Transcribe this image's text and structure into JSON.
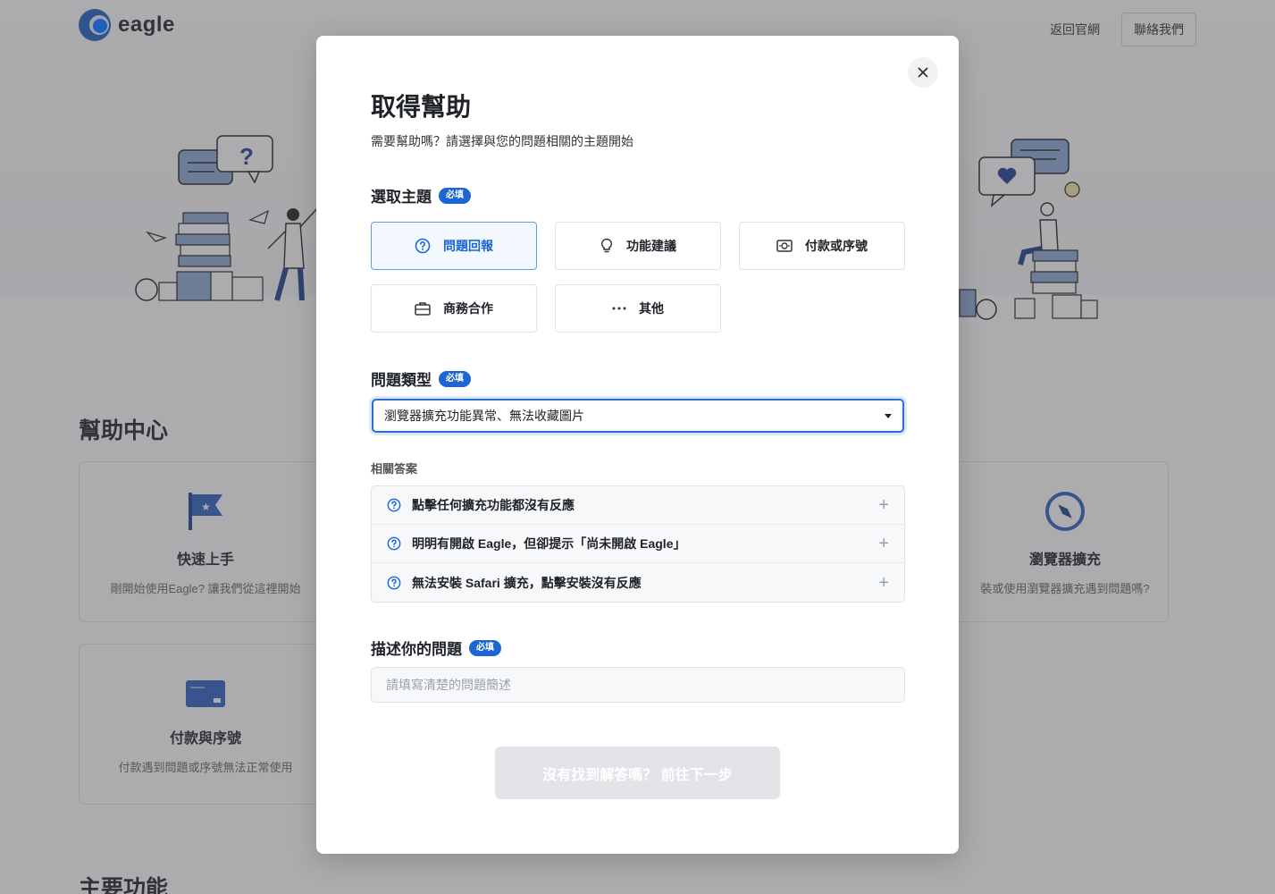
{
  "background": {
    "logo_text": "eagle",
    "nav": {
      "back_link": "返回官網",
      "contact_button": "聯絡我們"
    },
    "help_center_title": "幫助中心",
    "main_features_title": "主要功能",
    "cards": [
      {
        "title": "快速上手",
        "desc": "剛開始使用Eagle? 讓我們從這裡開始"
      },
      {
        "title": "瀏覽器擴充",
        "desc": "裝或使用瀏覽器擴充遇到問題嗎?"
      },
      {
        "title": "付款與序號",
        "desc": "付款遇到問題或序號無法正常使用"
      }
    ]
  },
  "modal": {
    "title": "取得幫助",
    "subtitle": "需要幫助嗎？請選擇與您的問題相關的主題開始",
    "required_badge": "必填",
    "topic": {
      "label": "選取主題",
      "options": [
        {
          "label": "問題回報",
          "icon": "question-circle-icon",
          "selected": true
        },
        {
          "label": "功能建議",
          "icon": "lightbulb-icon",
          "selected": false
        },
        {
          "label": "付款或序號",
          "icon": "money-icon",
          "selected": false
        },
        {
          "label": "商務合作",
          "icon": "briefcase-icon",
          "selected": false
        },
        {
          "label": "其他",
          "icon": "more-icon",
          "selected": false
        }
      ]
    },
    "issue_type": {
      "label": "問題類型",
      "selected_value": "瀏覽器擴充功能異常、無法收藏圖片"
    },
    "related_answers": {
      "label": "相關答案",
      "items": [
        "點擊任何擴充功能都沒有反應",
        "明明有開啟 Eagle，但卻提示「尚未開啟 Eagle」",
        "無法安裝 Safari 擴充，點擊安裝沒有反應"
      ]
    },
    "description": {
      "label": "描述你的問題",
      "placeholder": "請填寫清楚的問題簡述",
      "value": ""
    },
    "next_button": "沒有找到解答嗎？ 前往下一步"
  },
  "colors": {
    "accent": "#1b66d3",
    "selected_bg": "#f3f8fe",
    "disabled_button": "#e2e4e7",
    "overlay": "rgba(70,70,75,0.45)"
  }
}
